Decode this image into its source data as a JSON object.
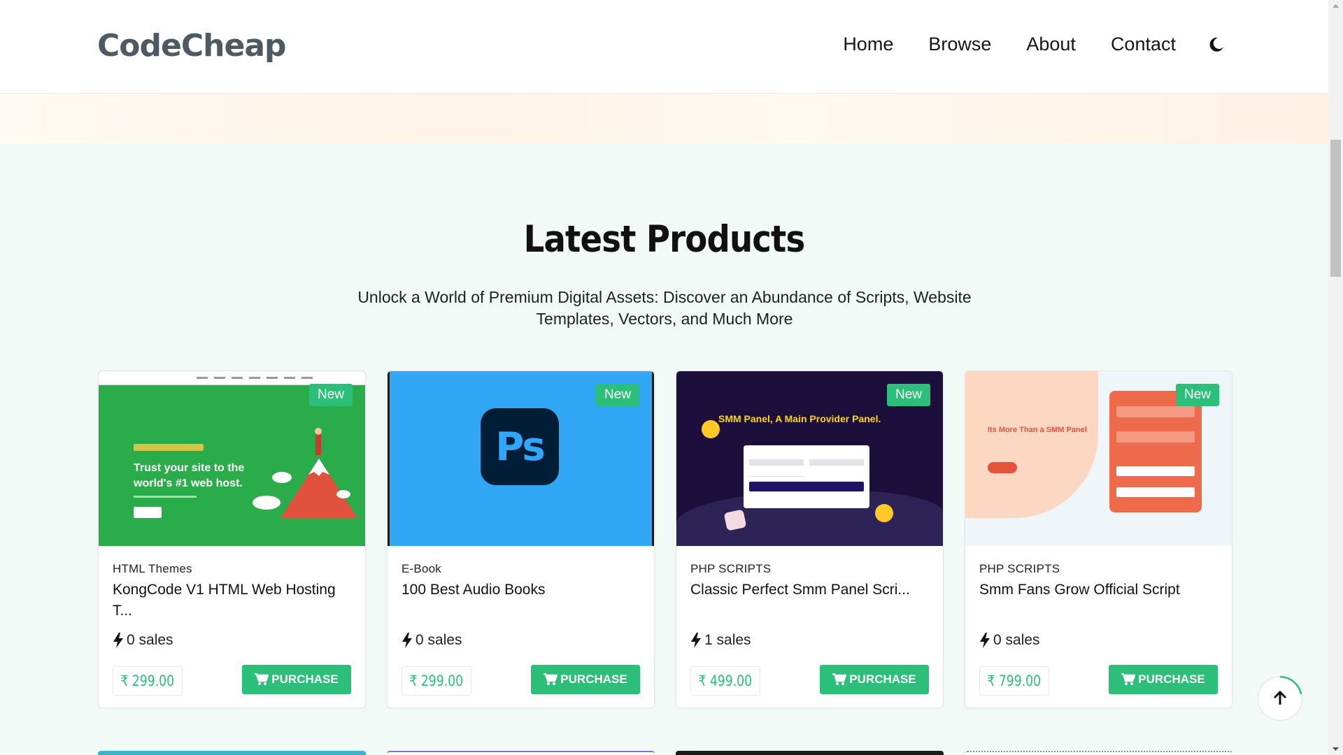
{
  "header": {
    "logo": "CodeCheap",
    "nav": [
      "Home",
      "Browse",
      "About",
      "Contact"
    ],
    "theme_icon": "moon-icon"
  },
  "section": {
    "title": "Latest Products",
    "subtitle": "Unlock a World of Premium Digital Assets: Discover an Abundance of Scripts, Website Templates, Vectors, and Much More"
  },
  "products": [
    {
      "badge": "New",
      "category": "HTML Themes",
      "title": "KongCode V1 HTML Web Hosting T...",
      "sales": "0 sales",
      "price": "₹ 299.00",
      "purchase": "PURCHASE",
      "thumb_text": "Trust your site to the world's #1 web host."
    },
    {
      "badge": "New",
      "category": "E-Book",
      "title": "100 Best Audio Books",
      "sales": "0 sales",
      "price": "₹ 299.00",
      "purchase": "PURCHASE",
      "thumb_text": "Ps"
    },
    {
      "badge": "New",
      "category": "PHP SCRIPTS",
      "title": "Classic Perfect Smm Panel Scri...",
      "sales": "1 sales",
      "price": "₹ 499.00",
      "purchase": "PURCHASE",
      "thumb_text": "SMM Panel, A Main Provider Panel."
    },
    {
      "badge": "New",
      "category": "PHP SCRIPTS",
      "title": "Smm Fans Grow Official Script",
      "sales": "0 sales",
      "price": "₹ 799.00",
      "purchase": "PURCHASE",
      "thumb_text": "Its More Than a SMM Panel"
    }
  ],
  "colors": {
    "accent": "#2bbf7a",
    "page_bg": "#f2faf8",
    "logo": "#4c5a63"
  }
}
